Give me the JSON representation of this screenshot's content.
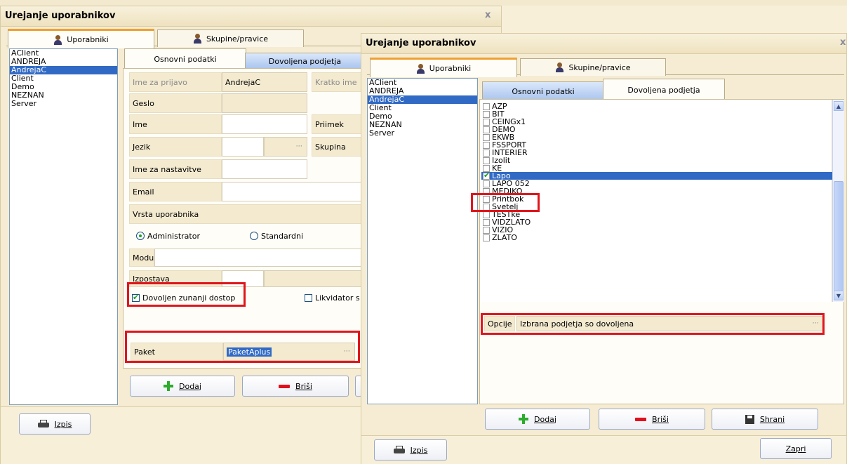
{
  "back_window": {
    "title": "Urejanje uporabnikov",
    "close_glyph": "x",
    "tabs": {
      "users": "Uporabniki",
      "groups": "Skupine/pravice"
    },
    "user_list": [
      "AClient",
      "ANDREJA",
      "AndrejaC",
      "Client",
      "Demo",
      "NEZNAN",
      "Server"
    ],
    "selected_user": "AndrejaC",
    "subtabs": {
      "basic": "Osnovni podatki",
      "companies": "Dovoljena podjetja"
    },
    "form": {
      "login_label": "Ime za prijavo",
      "login_value": "AndrejaC",
      "short_name_label": "Kratko ime",
      "password_label": "Geslo",
      "first_name_label": "Ime",
      "last_name_label": "Priimek",
      "language_label": "Jezik",
      "group_label": "Skupina",
      "settings_name_label": "Ime za nastavitve",
      "email_label": "Email",
      "user_type_label": "Vrsta uporabnika",
      "radio_admin": "Administrator",
      "radio_standard": "Standardni",
      "modules_label": "Moduli",
      "branch_label": "Izpostava",
      "external_access_label": "Dovoljen zunanji dostop",
      "liquidator_label": "Likvidator s",
      "package_label": "Paket",
      "package_value": "PaketAplus",
      "dots": "···"
    },
    "buttons": {
      "add": "Dodaj",
      "delete": "Briši",
      "print": "Izpis"
    }
  },
  "front_window": {
    "title": "Urejanje uporabnikov",
    "close_glyph": "x",
    "tabs": {
      "users": "Uporabniki",
      "groups": "Skupine/pravice"
    },
    "user_list": [
      "AClient",
      "ANDREJA",
      "AndrejaC",
      "Client",
      "Demo",
      "NEZNAN",
      "Server"
    ],
    "selected_user": "AndrejaC",
    "subtabs": {
      "basic": "Osnovni podatki",
      "companies": "Dovoljena podjetja"
    },
    "companies": [
      "AZP",
      "BIT",
      "CEINGx1",
      "DEMO",
      "EKWB",
      "FSSPORT",
      "INTERIER",
      "Izolit",
      "KE",
      "Lapo",
      "LAPO 052",
      "MEDIKO",
      "Printbok",
      "Svetelj",
      "TESTke",
      "VIDZLATO",
      "VIZIO",
      "ZLATO"
    ],
    "checked_company": "Lapo",
    "options_label": "Opcije",
    "options_value": "Izbrana podjetja so dovoljena",
    "dots": "···",
    "scroll_up": "▲",
    "scroll_down": "▼",
    "buttons": {
      "add": "Dodaj",
      "delete": "Briši",
      "save": "Shrani",
      "print": "Izpis",
      "close": "Zapri"
    }
  },
  "colors": {
    "highlight": "#e0161b",
    "selection": "#316ac5",
    "accent_tab": "#f0a030"
  }
}
